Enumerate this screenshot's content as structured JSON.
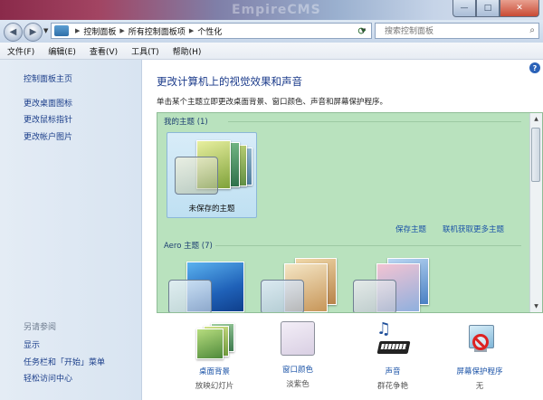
{
  "window": {
    "watermark": "EmpireCMS",
    "controls": {
      "min": "—",
      "max": "□",
      "close": "✕"
    }
  },
  "address": {
    "crumbs": [
      "控制面板",
      "所有控制面板项",
      "个性化"
    ],
    "search_placeholder": "搜索控制面板"
  },
  "menu": [
    "文件(F)",
    "编辑(E)",
    "查看(V)",
    "工具(T)",
    "帮助(H)"
  ],
  "sidebar": {
    "home": "控制面板主页",
    "links": [
      "更改桌面图标",
      "更改鼠标指针",
      "更改帐户图片"
    ],
    "see_also_title": "另请参阅",
    "see_also": [
      "显示",
      "任务栏和「开始」菜单",
      "轻松访问中心"
    ]
  },
  "main": {
    "heading": "更改计算机上的视觉效果和声音",
    "description": "单击某个主题立即更改桌面背景、窗口颜色、声音和屏幕保护程序。",
    "my_themes": "我的主题 (1)",
    "unsaved_theme": "未保存的主题",
    "save_theme": "保存主题",
    "get_more": "联机获取更多主题",
    "aero_themes": "Aero 主题 (7)"
  },
  "bottom": [
    {
      "title": "桌面背景",
      "value": "放映幻灯片"
    },
    {
      "title": "窗口颜色",
      "value": "淡紫色"
    },
    {
      "title": "声音",
      "value": "群花争艳"
    },
    {
      "title": "屏幕保护程序",
      "value": "无"
    }
  ],
  "colors": {
    "theme_panel_bg": "#b9e2be",
    "link": "#1b53a7",
    "heading": "#1a3a8a",
    "sidebar_bg": "#dce7f3"
  }
}
